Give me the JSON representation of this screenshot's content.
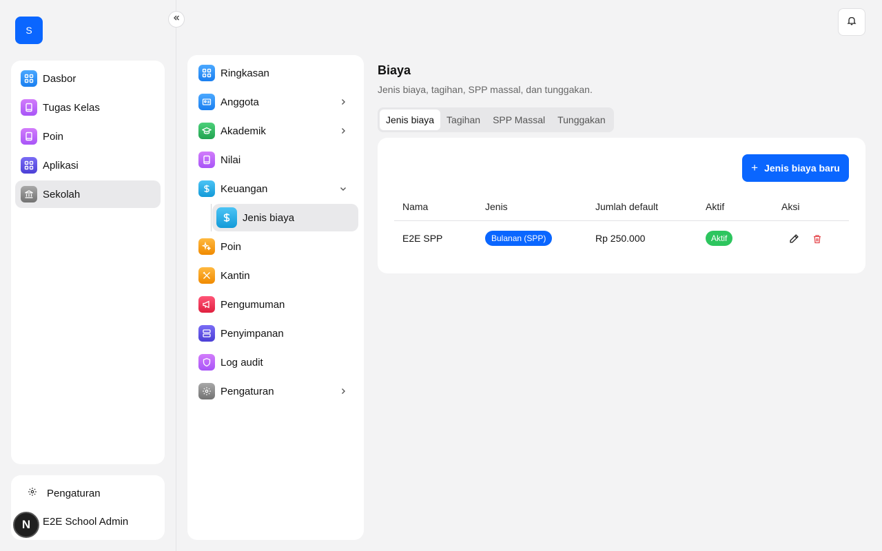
{
  "brand": {
    "initial": "S"
  },
  "sidebar": {
    "items": [
      {
        "label": "Dasbor",
        "icon": "grid-icon",
        "color": "#1a8cff"
      },
      {
        "label": "Tugas Kelas",
        "icon": "book-icon",
        "color": "#b05cf0"
      },
      {
        "label": "Poin",
        "icon": "book-icon",
        "color": "#b05cf0"
      },
      {
        "label": "Aplikasi",
        "icon": "grid-icon",
        "color": "#5a4de8"
      },
      {
        "label": "Sekolah",
        "icon": "bank-icon",
        "color": "#8a8a8a",
        "active": true
      }
    ],
    "footer": {
      "settings_label": "Pengaturan",
      "user_name": "E2E School Admin",
      "avatar_letter": "N"
    }
  },
  "subnav": {
    "items": [
      {
        "label": "Ringkasan",
        "icon": "grid-icon",
        "color": "#1a7ff0"
      },
      {
        "label": "Anggota",
        "icon": "id-card-icon",
        "color": "#1a7ff0",
        "chevron": "right"
      },
      {
        "label": "Akademik",
        "icon": "graduation-cap-icon",
        "color": "#2db35d",
        "chevron": "right"
      },
      {
        "label": "Nilai",
        "icon": "book-icon",
        "color": "#a855f7"
      },
      {
        "label": "Keuangan",
        "icon": "dollar-icon",
        "color": "#18a6e6",
        "chevron": "down"
      }
    ],
    "child": {
      "label": "Jenis biaya",
      "icon": "dollar-icon",
      "color": "#18a6e6"
    },
    "items_after": [
      {
        "label": "Poin",
        "icon": "sparkle-icon",
        "color": "#f59a12"
      },
      {
        "label": "Kantin",
        "icon": "utensils-icon",
        "color": "#f59a12"
      },
      {
        "label": "Pengumuman",
        "icon": "megaphone-icon",
        "color": "#ec2b4d"
      },
      {
        "label": "Penyimpanan",
        "icon": "server-icon",
        "color": "#5a4de8"
      },
      {
        "label": "Log audit",
        "icon": "shield-icon",
        "color": "#a855f7"
      },
      {
        "label": "Pengaturan",
        "icon": "gear-icon",
        "color": "#8a8a8a",
        "chevron": "right"
      }
    ]
  },
  "page": {
    "title": "Biaya",
    "subtitle": "Jenis biaya, tagihan, SPP massal, dan tunggakan.",
    "tabs": [
      {
        "label": "Jenis biaya",
        "active": true
      },
      {
        "label": "Tagihan"
      },
      {
        "label": "SPP Massal"
      },
      {
        "label": "Tunggakan"
      }
    ],
    "new_button_label": "Jenis biaya baru",
    "table": {
      "headers": [
        "Nama",
        "Jenis",
        "Jumlah default",
        "Aktif",
        "Aksi"
      ],
      "rows": [
        {
          "name": "E2E SPP",
          "type": "Bulanan (SPP)",
          "amount": "Rp 250.000",
          "active": "Aktif"
        }
      ]
    }
  },
  "colors": {
    "accent": "#0a66ff",
    "success": "#2dc55e",
    "danger": "#e5484d"
  }
}
